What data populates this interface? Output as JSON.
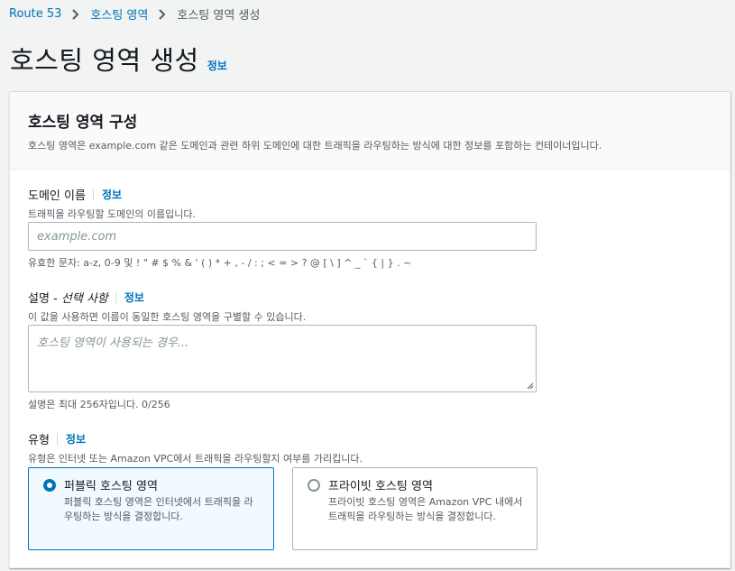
{
  "breadcrumb": {
    "items": [
      "Route 53",
      "호스팅 영역"
    ],
    "current": "호스팅 영역 생성"
  },
  "page": {
    "title": "호스팅 영역 생성",
    "info": "정보"
  },
  "panel": {
    "title": "호스팅 영역 구성",
    "description": "호스팅 영역은 example.com 같은 도메인과 관련 하위 도메인에 대한 트래픽을 라우팅하는 방식에 대한 정보를 포함하는 컨테이너입니다."
  },
  "domain": {
    "label": "도메인 이름",
    "info": "정보",
    "description": "트래픽을 라우팅할 도메인의 이름입니다.",
    "placeholder": "example.com",
    "constraint": "유효한 문자: a-z, 0-9 및 ! \" # $ % & ' ( ) * + , - / : ; < = > ? @ [ \\ ] ^ _ ` { | } . ~"
  },
  "description_field": {
    "label_main": "설명 - ",
    "label_optional": "선택 사항",
    "info": "정보",
    "description": "이 값을 사용하면 이름이 동일한 호스팅 영역을 구별할 수 있습니다.",
    "placeholder": "호스팅 영역이 사용되는 경우...",
    "constraint": "설명은 최대 256자입니다. 0/256"
  },
  "type": {
    "label": "유형",
    "info": "정보",
    "description": "유형은 인터넷 또는 Amazon VPC에서 트래픽을 라우팅할지 여부를 가리킵니다.",
    "options": [
      {
        "title": "퍼블릭 호스팅 영역",
        "description": "퍼블릭 호스팅 영역은 인터넷에서 트래픽을 라우팅하는 방식을 결정합니다.",
        "selected": true
      },
      {
        "title": "프라이빗 호스팅 영역",
        "description": "프라이빗 호스팅 영역은 Amazon VPC 내에서 트래픽을 라우팅하는 방식을 결정합니다.",
        "selected": false
      }
    ]
  },
  "colors": {
    "accent": "#0073bb",
    "selected_bg": "#f1faff"
  }
}
